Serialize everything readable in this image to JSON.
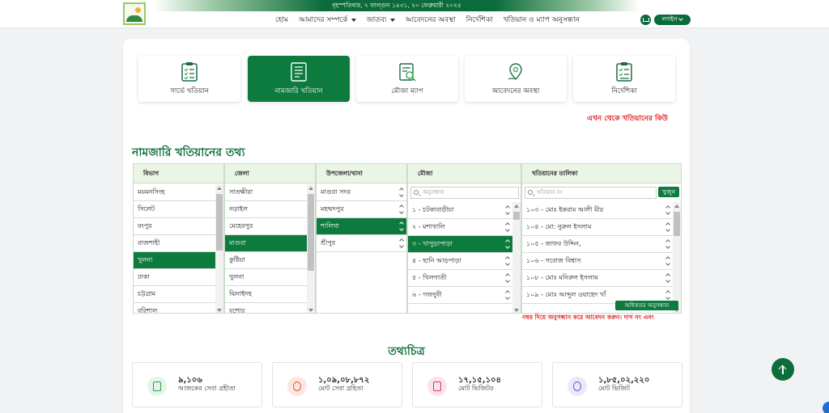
{
  "header": {
    "date_line": "বৃহস্পতিবার, ৭ ফাল্গুন ১৪৩১, ২০ ফেব্রুয়ারী ২০২৫",
    "nav": [
      {
        "label": "হোম",
        "has_dropdown": false
      },
      {
        "label": "আমাদের সম্পর্কে",
        "has_dropdown": true
      },
      {
        "label": "জাতব্য",
        "has_dropdown": true
      },
      {
        "label": "আবেদনের অবস্থা",
        "has_dropdown": false
      },
      {
        "label": "নির্দেশিকা",
        "has_dropdown": false
      },
      {
        "label": "খতিয়ান ও ম্যাপ অনুসন্ধান",
        "has_dropdown": false
      }
    ],
    "login_label": "লগইন"
  },
  "services": [
    {
      "label": "সার্ভে খতিয়ান",
      "icon": "clipboard-checklist-icon",
      "active": false
    },
    {
      "label": "নামজারি খতিয়ান",
      "icon": "document-ledger-icon",
      "active": true
    },
    {
      "label": "মৌজা ম্যাপ",
      "icon": "map-search-icon",
      "active": false
    },
    {
      "label": "আবেদনের অবস্থা",
      "icon": "location-status-icon",
      "active": false
    },
    {
      "label": "নির্দেশিকা",
      "icon": "guideline-checklist-icon",
      "active": false
    }
  ],
  "marquee_text": "এখন থেকে খতিয়ানের কিউ",
  "section_title": "নামজারি খতিয়ানের তথ্য",
  "columns": {
    "division": {
      "header": "বিভাগ",
      "items": [
        "ময়মনসিংহ",
        "সিলেট",
        "রংপুর",
        "রাজশাহী",
        "খুলনা",
        "ঢাকা",
        "চট্টগ্রাম",
        "বরিশাল"
      ],
      "selected": 4
    },
    "district": {
      "header": "জেলা",
      "items": [
        "সাতক্ষীরা",
        "নড়াইল",
        "মেহেরপুর",
        "মাগুরা",
        "কুষ্টিয়া",
        "খুলনা",
        "ঝিনাইদহ",
        "যশোর"
      ],
      "selected": 3
    },
    "upazila": {
      "header": "উপজেলা/থানা",
      "items": [
        "মাগুরা সদর",
        "মহম্মদপুর",
        "শালিখা",
        "শ্রীপুর"
      ],
      "selected": 2
    },
    "mouza": {
      "header": "মৌজা",
      "search_placeholder": "অনুসন্ধান",
      "items": [
        "১ - চটকাবাড়ীয়া",
        "২ - মশাখালি",
        "৩ - খাপুড়াপাড়া",
        "৪ - ছানি আড়পাড়া",
        "৫ - খিলগাতী",
        "৬ - গজদুবী"
      ],
      "selected": 2
    },
    "khatian": {
      "header": "খতিয়ানের তালিকা",
      "search_placeholder": "খতিয়ান নং",
      "find_label": "খুজুন",
      "items": [
        "১০৩ - মোঃ ইকরাম আলী মীর",
        "১০৪ - মো: নুরুল ইসলাম",
        "১০৫ - জাফর উদ্দিন,",
        "১০৬ - সরোজ বিশ্বাস",
        "১০৮ - মোঃ মনিরুল ইসলাম",
        "১০৯ - মোঃ আব্দুল ওয়াহেদ খাঁ"
      ],
      "advanced_label": "অধিকতর অনুসন্ধান"
    }
  },
  "note_text": "নম্বর দিয়ে অনুসন্ধান করে আবেদন করুন। দাগ নং এবং",
  "stats_title": "তথ্যচিত্র",
  "stats": [
    {
      "value": "৯,১০৬",
      "label": "আজকের সেবা গ্রহীতা",
      "icon": "receipt-icon",
      "color": "#2e9e57",
      "bg": "#e3f4e8"
    },
    {
      "value": "১,০৯,০৮,৮৭২",
      "label": "মোট সেবা গ্রহিতা",
      "icon": "hand-service-icon",
      "color": "#e2562f",
      "bg": "#fbe7e1"
    },
    {
      "value": "১৭,১৫,১০৪",
      "label": "মোট ভিজিটর",
      "icon": "document-icon",
      "color": "#d6336c",
      "bg": "#fbe3ec"
    },
    {
      "value": "১,৮৫,০২,২২০",
      "label": "মোট ভিজিট",
      "icon": "percent-badge-icon",
      "color": "#6b5bc9",
      "bg": "#ebe8f8"
    }
  ],
  "colors": {
    "brand": "#0d7a3e",
    "alert": "#e0262c"
  }
}
